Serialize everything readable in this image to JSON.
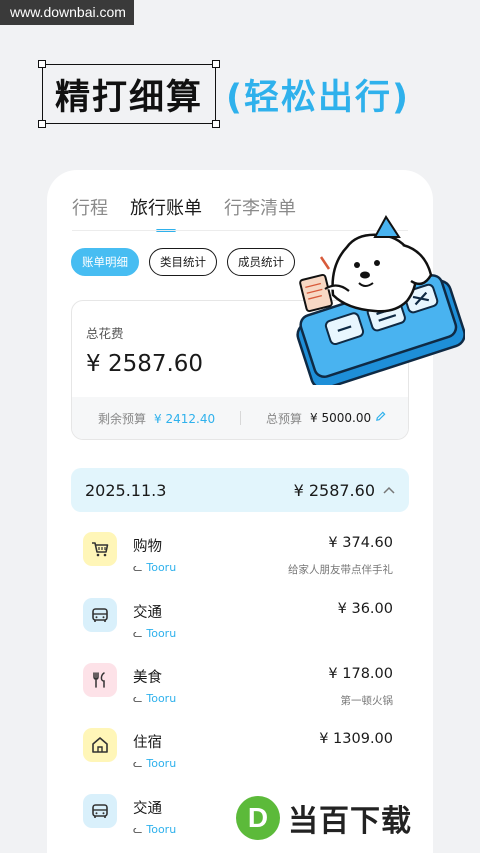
{
  "watermark_top": "www.downbai.com",
  "headline": {
    "main": "精打细算",
    "sub": "(轻松出行)"
  },
  "tabs": [
    {
      "label": "行程"
    },
    {
      "label": "旅行账单"
    },
    {
      "label": "行李清单"
    }
  ],
  "active_tab": 1,
  "chips": [
    {
      "label": "账单明细"
    },
    {
      "label": "类目统计"
    },
    {
      "label": "成员统计"
    }
  ],
  "summary": {
    "label": "总花费",
    "amount": "¥ 2587.60",
    "remaining_label": "剩余预算",
    "remaining_value": "¥ 2412.40",
    "budget_label": "总预算",
    "budget_value": "¥ 5000.00"
  },
  "day": {
    "date": "2025.11.3",
    "total": "¥ 2587.60"
  },
  "expenses": [
    {
      "name": "购物",
      "user": "Tooru",
      "amount": "¥ 374.60",
      "note": "给家人朋友带点伴手礼",
      "icon": "cart-icon",
      "color": "#fff6b8"
    },
    {
      "name": "交通",
      "user": "Tooru",
      "amount": "¥ 36.00",
      "note": "",
      "icon": "bus-icon",
      "color": "#d9f0fb"
    },
    {
      "name": "美食",
      "user": "Tooru",
      "amount": "¥ 178.00",
      "note": "第一顿火锅",
      "icon": "utensils-icon",
      "color": "#fde2e8"
    },
    {
      "name": "住宿",
      "user": "Tooru",
      "amount": "¥ 1309.00",
      "note": "",
      "icon": "house-icon",
      "color": "#fff6b8"
    },
    {
      "name": "交通",
      "user": "Tooru",
      "amount": "",
      "note": "",
      "icon": "bus-icon",
      "color": "#d9f0fb"
    }
  ],
  "logo_watermark": {
    "letter": "D",
    "brand": "当百下载"
  },
  "colors": {
    "accent": "#2fb1ec",
    "chip_active": "#47bdf2",
    "day_bg": "#e2f5fc"
  }
}
